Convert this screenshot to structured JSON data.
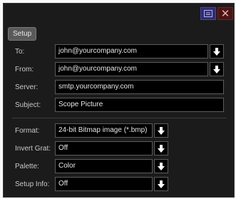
{
  "tab": {
    "label": "Setup"
  },
  "email": {
    "to": {
      "label": "To:",
      "value": "john@yourcompany.com"
    },
    "from": {
      "label": "From:",
      "value": "john@yourcompany.com"
    },
    "server": {
      "label": "Server:",
      "value": "smtp.yourcompany.com"
    },
    "subject": {
      "label": "Subject:",
      "value": "Scope Picture"
    }
  },
  "image": {
    "format": {
      "label": "Format:",
      "value": "24-bit Bitmap image (*.bmp)"
    },
    "invert_grat": {
      "label": "Invert Grat:",
      "value": "Off"
    },
    "palette": {
      "label": "Palette:",
      "value": "Color"
    },
    "setup_info": {
      "label": "Setup Info:",
      "value": "Off"
    }
  },
  "icons": {
    "help": "help-panel-icon",
    "close": "close-icon",
    "dropdown": "arrow-down-icon"
  },
  "colors": {
    "help_button": "#2f2c72",
    "close_button": "#4b1414",
    "field_bg": "#000000"
  }
}
